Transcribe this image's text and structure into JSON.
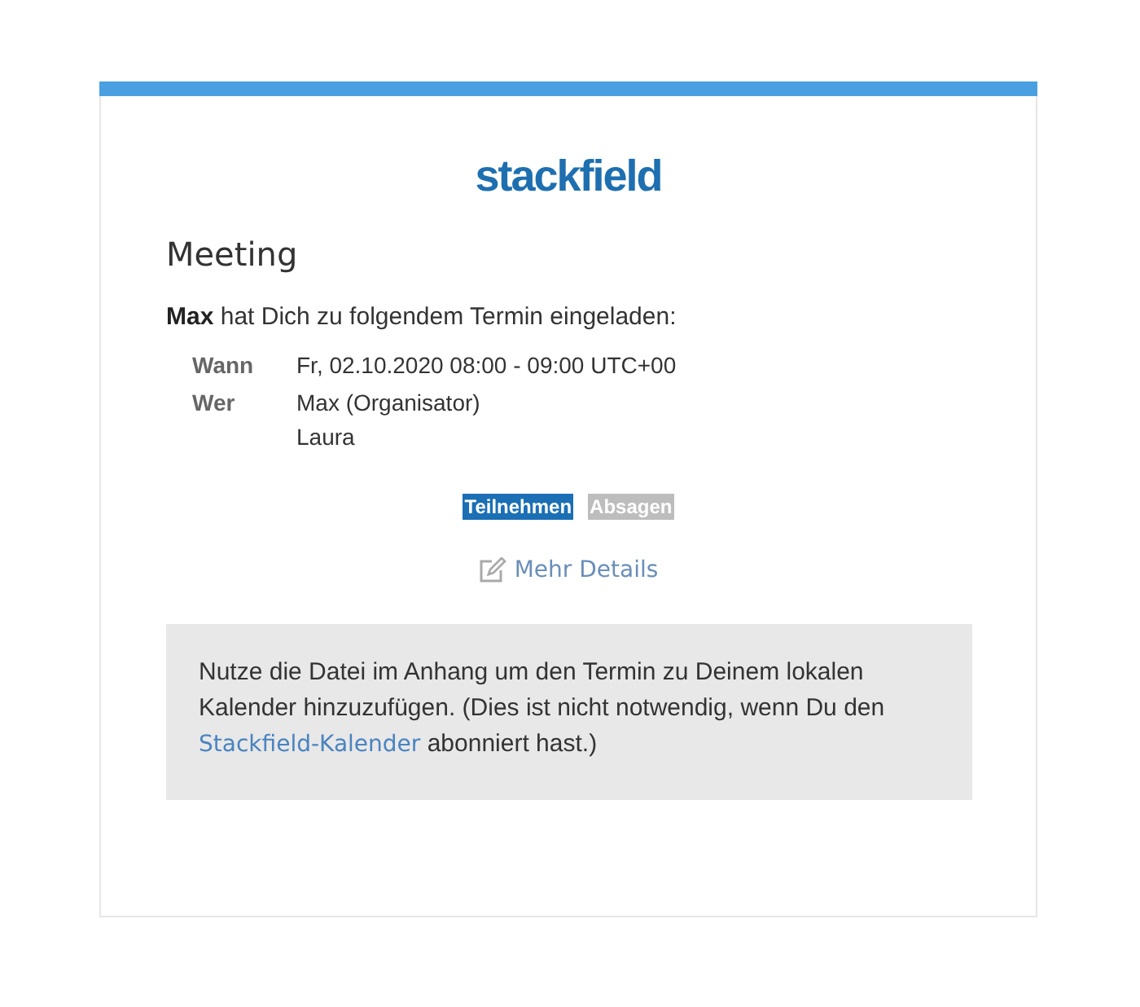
{
  "logo": "stackfield",
  "title": "Meeting",
  "invitation": "**Max** hat Dich zu folgendem Termin eingeladen:",
  "details": [
    {
      "label": "Wann",
      "values": [
        "Fr, 02.10.2020 08:00 - 09:00 UTC+00"
      ]
    },
    {
      "label": "Wer",
      "values": [
        "Max (Organisator)",
        "Laura"
      ]
    }
  ],
  "buttons": [
    {
      "label": "Teilnehmen",
      "kind": "primary"
    },
    {
      "label": "Absagen",
      "kind": "secondary"
    }
  ],
  "details_link": "Mehr Details",
  "note": {
    "before": "Nutze die Datei im Anhang um den Termin zu Deinem lokalen Kalender hinzuzufügen. (Dies ist nicht notwendig, wenn Du den",
    "link": "Stackfield-Kalender",
    "after": "abonniert hast.)"
  }
}
